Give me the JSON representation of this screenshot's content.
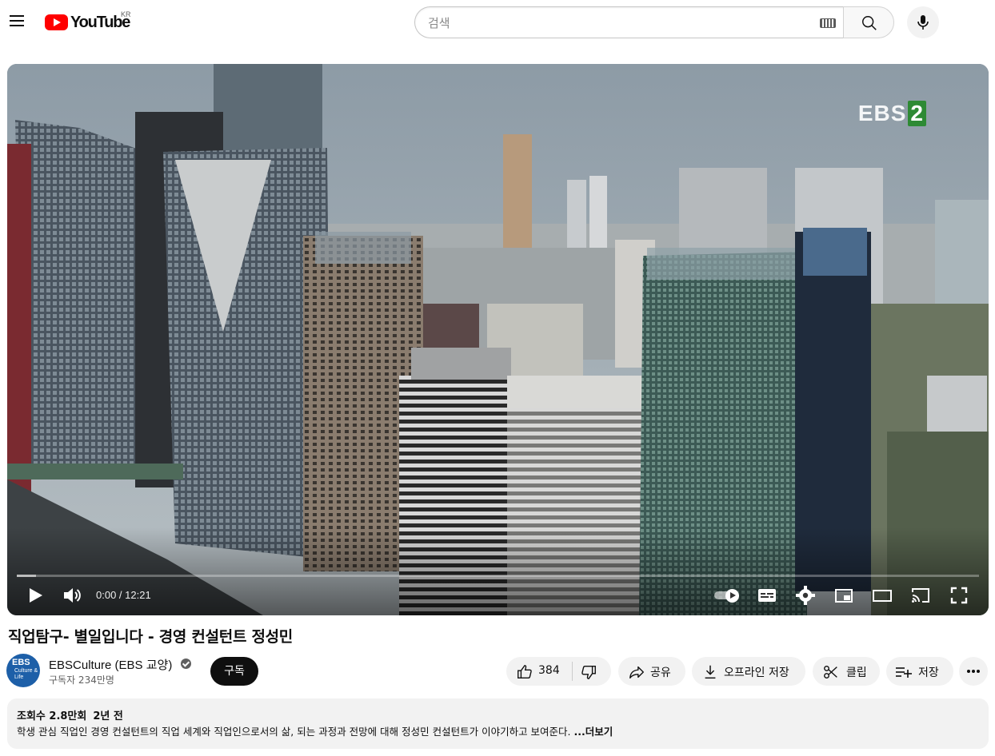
{
  "header": {
    "logo_text": "YouTube",
    "country_code": "KR",
    "search_placeholder": "검색",
    "icons": [
      "menu-icon",
      "keyboard-icon",
      "search-icon",
      "mic-icon"
    ]
  },
  "player": {
    "watermark_text": "EBS",
    "watermark_number": "2",
    "time_display": "0:00 / 12:21",
    "progress_fraction": 0.0,
    "buffered_fraction": 0.02,
    "autoplay_on": true
  },
  "video": {
    "title": "직업탐구- 별일입니다 - 경영 컨설턴트 정성민"
  },
  "channel": {
    "name": "EBSCulture (EBS 교양)",
    "subscribers": "구독자 234만명",
    "avatar_line1": "EBS",
    "avatar_line2": "Culture & Life",
    "verified": true
  },
  "actions": {
    "subscribe_label": "구독",
    "like_count": "384",
    "share_label": "공유",
    "download_label": "오프라인 저장",
    "clip_label": "클립",
    "save_label": "저장"
  },
  "description": {
    "views": "조회수 2.8만회",
    "age": "2년 전",
    "text": "학생 관심 직업인 경영 컨설턴트의 직업 세계와 직업인으로서의 삶, 되는 과정과 전망에 대해 정성민 컨설턴트가 이야기하고 보여준다. ",
    "more_label": "...더보기"
  },
  "colors": {
    "brand_red": "#ff0000",
    "chip_bg": "#f2f2f2",
    "text_primary": "#0f0f0f",
    "text_secondary": "#606060"
  }
}
